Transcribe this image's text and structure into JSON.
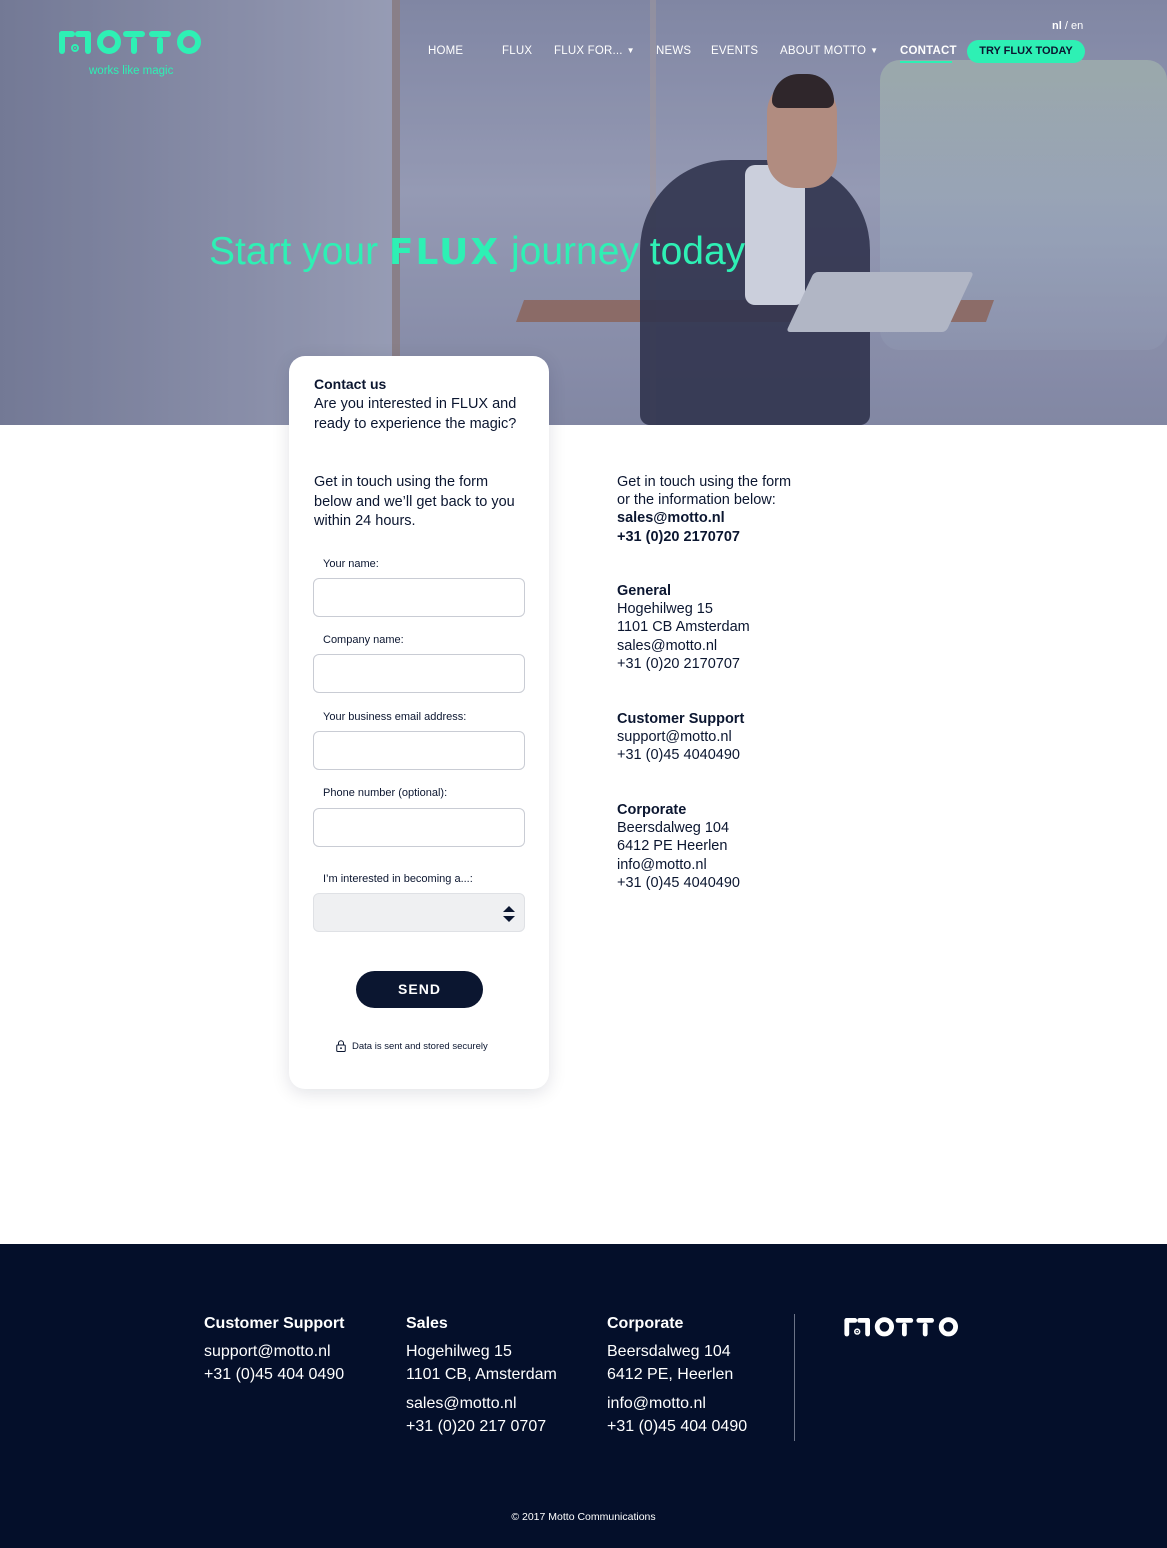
{
  "brand": {
    "tagline": "works like magic",
    "accent_color": "#2ef0b4",
    "dark_color": "#0b1630"
  },
  "lang": {
    "nl": "nl",
    "sep": " / ",
    "en": "en"
  },
  "nav": {
    "items": [
      {
        "label": "HOME"
      },
      {
        "label": "FLUX"
      },
      {
        "label": "FLUX FOR..."
      },
      {
        "label": "NEWS"
      },
      {
        "label": "EVENTS"
      },
      {
        "label": "ABOUT MOTTO"
      },
      {
        "label": "CONTACT"
      }
    ],
    "cta": "TRY FLUX TODAY"
  },
  "hero": {
    "title_pre": "Start your ",
    "title_flux": "FLUX",
    "title_post": " journey today"
  },
  "form": {
    "title": "Contact us",
    "intro": "Are you interested in FLUX and ready to experience the magic?",
    "intro2": "Get in touch using the form below and we’ll get back to you within 24 hours.",
    "fields": [
      {
        "label": "Your name:",
        "value": ""
      },
      {
        "label": "Company name:",
        "value": ""
      },
      {
        "label": "Your business email address:",
        "value": ""
      },
      {
        "label": "Phone number (optional):",
        "value": ""
      }
    ],
    "select_label": "I’m interested in becoming a...:",
    "select_value": "",
    "send": "SEND",
    "secure_note": "Data is sent and stored securely"
  },
  "contact": {
    "intro": [
      "Get in touch using the form",
      "or the information below:"
    ],
    "email": "sales@motto.nl",
    "phone": "+31 (0)20 2170707",
    "general": {
      "title": "General",
      "lines": [
        "Hogehilweg 15",
        "1101 CB Amsterdam",
        "sales@motto.nl",
        "+31 (0)20 2170707"
      ]
    },
    "support": {
      "title": "Customer Support",
      "lines": [
        "support@motto.nl",
        "+31 (0)45 4040490"
      ]
    },
    "corporate": {
      "title": "Corporate",
      "lines": [
        "Beersdalweg 104",
        "6412 PE Heerlen",
        "info@motto.nl",
        "+31 (0)45 4040490"
      ]
    }
  },
  "footer": {
    "support": {
      "title": "Customer Support",
      "email": "support@motto.nl",
      "phone": "+31 (0)45 404 0490"
    },
    "sales": {
      "title": "Sales",
      "addr1": "Hogehilweg 15",
      "addr2": "1101 CB, Amsterdam",
      "email": "sales@motto.nl",
      "phone": "+31 (0)20 217 0707"
    },
    "corporate": {
      "title": "Corporate",
      "addr1": "Beersdalweg 104",
      "addr2": "6412 PE, Heerlen",
      "email": "info@motto.nl",
      "phone": "+31 (0)45 404 0490"
    },
    "copyright": "© 2017 Motto Communications"
  }
}
